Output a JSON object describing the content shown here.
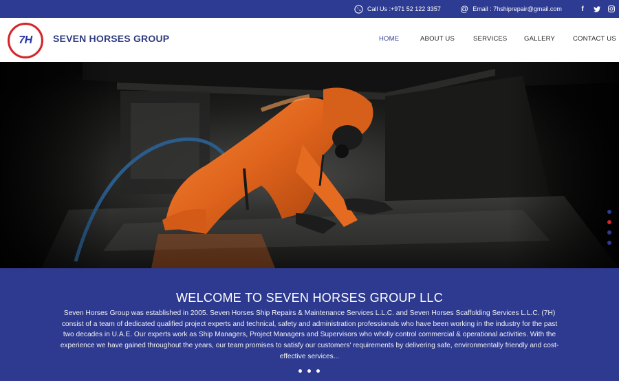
{
  "topbar": {
    "phone_icon": "phone-icon",
    "phone_text": "Call Us :+971 52 122 3357",
    "email_icon": "at-icon",
    "email_text": "Email : 7hshiprepair@gmail.com",
    "social": [
      {
        "name": "facebook-icon",
        "glyph": "f"
      },
      {
        "name": "twitter-icon",
        "glyph": "t"
      },
      {
        "name": "instagram-icon",
        "glyph": "◎"
      }
    ]
  },
  "header": {
    "logo_text": "7H",
    "brand": "SEVEN HORSES GROUP",
    "menu": [
      {
        "label": "HOME",
        "active": true
      },
      {
        "label": "ABOUT US",
        "active": false
      },
      {
        "label": "SERVICES",
        "active": false
      },
      {
        "label": "GALLERY",
        "active": false
      },
      {
        "label": "CONTACT US",
        "active": false
      }
    ]
  },
  "hero": {
    "image": "worker-in-orange-protective-suit-cleaning-tank-floor",
    "slide_count": 4,
    "active_slide": 2
  },
  "welcome": {
    "title": "WELCOME TO SEVEN HORSES GROUP LLC",
    "text": "Seven Horses Group was established in 2005. Seven Horses Ship Repairs & Maintenance Services L.L.C. and Seven Horses Scaffolding Services L.L.C. (7H) consist of a team of dedicated qualified project experts and technical, safety and administration professionals who have been working in the industry for the past two decades in U.A.E. Our experts work as Ship Managers, Project Managers and Supervisors who wholly control commercial & operational activities. With the experience we have gained throughout the years, our team promises to satisfy our customers' requirements by delivering safe, environmentally friendly and cost-effective services...",
    "carousel_dots": 3
  },
  "colors": {
    "primary": "#2e3b92",
    "accent": "#d6232a",
    "suit": "#e8691f"
  }
}
